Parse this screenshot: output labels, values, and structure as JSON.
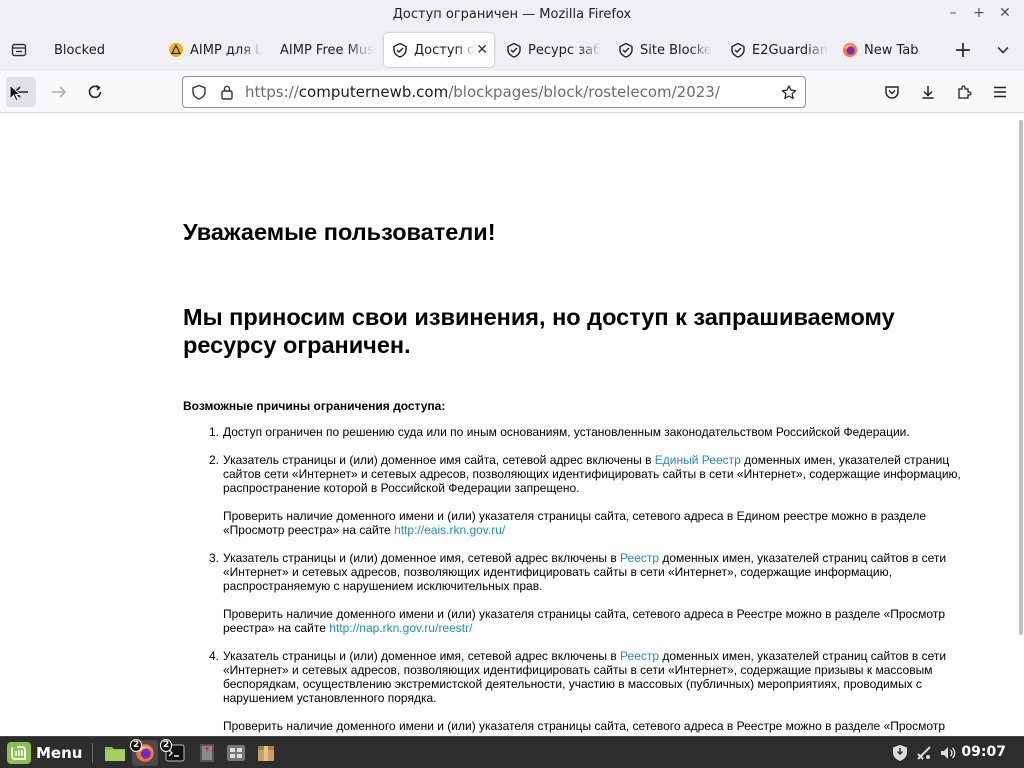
{
  "window": {
    "title": "Доступ ограничен — Mozilla Firefox"
  },
  "tabs": [
    {
      "label": "Blocked",
      "icon": "folder-tab-icon",
      "active": false
    },
    {
      "label": "AIMP для L",
      "icon": "warning-triangle-icon",
      "active": false
    },
    {
      "label": "AIMP Free Mus",
      "icon": "",
      "active": false
    },
    {
      "label": "Доступ о",
      "icon": "shield-tab-icon",
      "active": true
    },
    {
      "label": "Ресурс заб",
      "icon": "shield-tab-icon",
      "active": false
    },
    {
      "label": "Site Blocke",
      "icon": "shield-tab-icon",
      "active": false
    },
    {
      "label": "E2Guardian",
      "icon": "shield-tab-icon",
      "active": false
    },
    {
      "label": "New Tab",
      "icon": "firefox-icon",
      "active": false
    }
  ],
  "navbar": {
    "url_prefix": "https://",
    "url_domain": "computernewb.com",
    "url_path": "/blockpages/block/rostelecom/2023/"
  },
  "page": {
    "greeting": "Уважаемые пользователи!",
    "apology": "Мы приносим свои извинения, но доступ к запрашиваемому ресурсу ограничен.",
    "reasons_title": "Возможные причины ограничения доступа:",
    "reasons": [
      {
        "num": "1.",
        "text": "Доступ ограничен  по решению суда или по иным основаниям, установленным законодательством Российской Федерации."
      },
      {
        "num": "2.",
        "text_before": "Указатель страницы и (или) доменное имя сайта, сетевой адрес включены в ",
        "link": "Единый Реестр",
        "text_after": " доменных имен, указателей страниц сайтов сети «Интернет» и сетевых адресов, позволяющих идентифицировать сайты в сети «Интернет», содержащие информацию, распространение которой в Российской Федерации запрещено.",
        "check_text": "Проверить наличие доменного имени и (или) указателя страницы сайта, сетевого адреса в Едином реестре можно в разделе «Просмотр реестра» на сайте ",
        "check_link": "http://eais.rkn.gov.ru/"
      },
      {
        "num": "3.",
        "text_before": "Указатель страницы и (или) доменное имя, сетевой адрес включены в ",
        "link": "Реестр",
        "text_after": " доменных имен, указателей страниц сайтов в сети «Интернет» и сетевых адресов, позволяющих идентифицировать сайты в сети «Интернет», содержащие информацию, распространяемую с нарушением исключительных прав.",
        "check_text": "Проверить наличие доменного имени и (или) указателя страницы сайта, сетевого адреса в Реестре можно в разделе «Просмотр реестра» на сайте ",
        "check_link": "http://nap.rkn.gov.ru/reestr/"
      },
      {
        "num": "4.",
        "text_before": "Указатель страницы и (или) доменное имя, сетевой адрес включены в ",
        "link": "Реестр",
        "text_after": " доменных имен, указателей страниц сайтов в сети «Интернет» и сетевых адресов, позволяющих идентифицировать сайты в сети «Интернет», содержащие призывы к массовым беспорядкам, осуществлению экстремистской деятельности, участию в массовых (публичных) мероприятиях, проводимых с нарушением установленного порядка.",
        "check_text": "Проверить наличие доменного имени и (или) указателя страницы сайта, сетевого адреса в Реестре можно в разделе «Просмотр"
      }
    ]
  },
  "taskbar": {
    "menu_label": "Menu",
    "badge_firefox": "2",
    "badge_terminal": "2",
    "clock": "09:07"
  },
  "colors": {
    "link": "#1a8fc0",
    "mint_green": "#87c447",
    "taskbar_bg": "#2d2d2d"
  }
}
